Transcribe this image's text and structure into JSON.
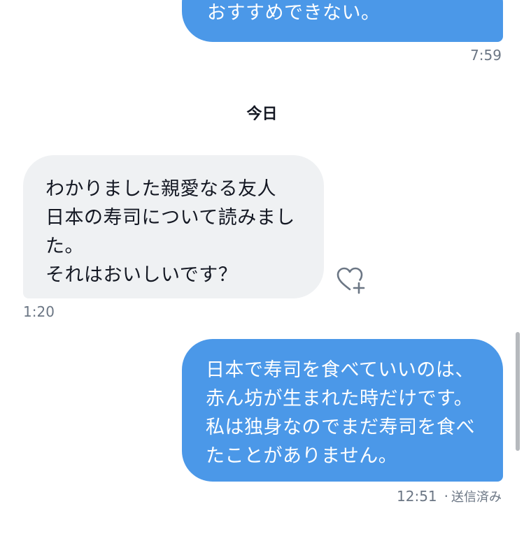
{
  "conversation": {
    "messages": [
      {
        "direction": "sent",
        "lines": [
          "おすすめできない。"
        ],
        "time": "7:59"
      },
      {
        "direction": "received",
        "lines": [
          "わかりました親愛なる友人",
          "日本の寿司について読みまし",
          "た。",
          "それはおいしいです？"
        ],
        "time": "1:20"
      },
      {
        "direction": "sent",
        "lines": [
          "日本で寿司を食べていいのは、",
          "赤ん坊が生まれた時だけです。",
          "私は独身なのでまだ寿司を食べ",
          "たことがありません。"
        ],
        "time": "12:51",
        "separator": "·",
        "status": "送信済み"
      }
    ],
    "date_separator": "今日"
  },
  "icons": {
    "reaction": "heart-plus-icon"
  },
  "colors": {
    "sent_bubble": "#4b98e8",
    "received_bubble": "#eff1f3",
    "timestamp": "#6b7684",
    "text_dark": "#141823"
  }
}
